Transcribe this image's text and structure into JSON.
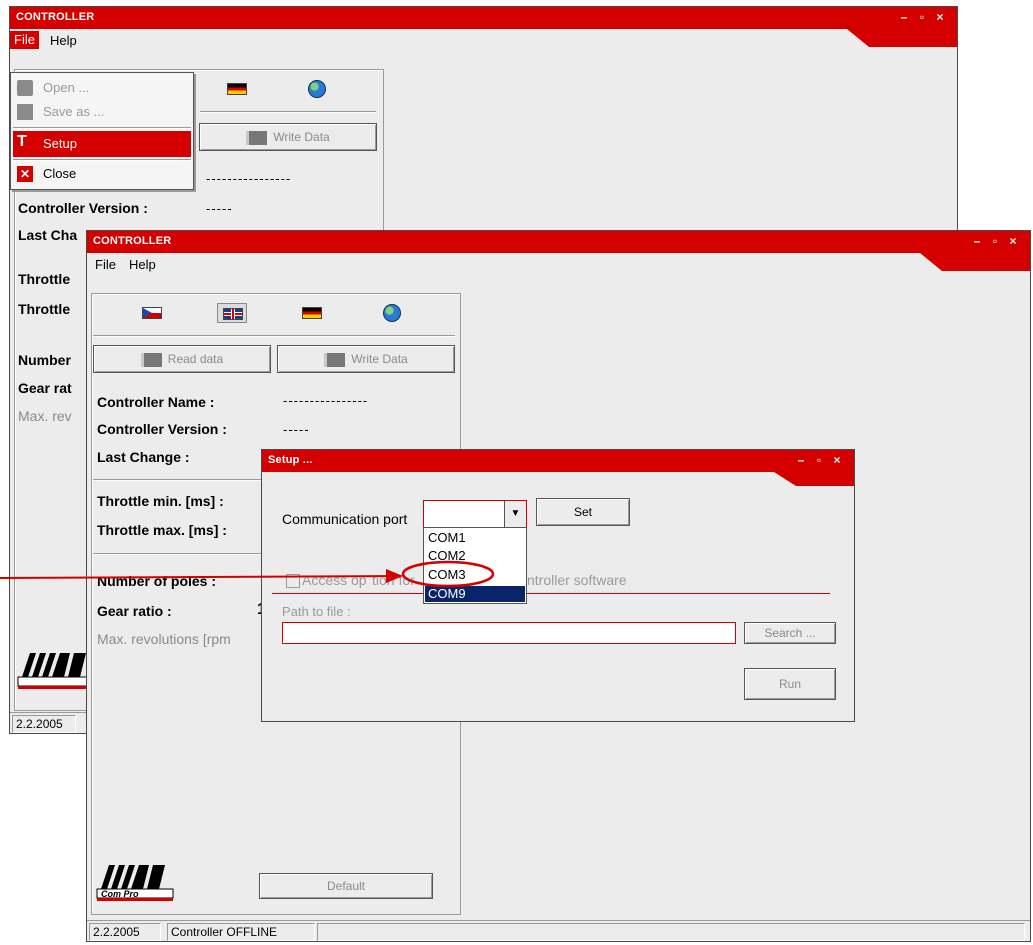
{
  "back_window": {
    "title": "CONTROLLER",
    "window_controls": [
      "–",
      "▫",
      "×"
    ],
    "menu": [
      "File",
      "Help"
    ],
    "write_button": "Write Data",
    "name_value": "----------------",
    "version_label": "Controller Version :",
    "version_value": "-----",
    "truncated_labels": [
      "Last Cha",
      "Throttle",
      "Throttle",
      "Number",
      "Gear rat",
      "Max. rev"
    ],
    "status_date": "2.2.2005",
    "file_menu": [
      {
        "label": "Open ...",
        "icon": "open-icon",
        "enabled": false
      },
      {
        "label": "Save as ...",
        "icon": "save-icon",
        "enabled": false
      },
      {
        "label": "Setup",
        "icon": "hammer-icon",
        "enabled": true,
        "highlighted": true
      },
      {
        "label": "Close",
        "icon": "close-icon",
        "enabled": true
      }
    ]
  },
  "main_window": {
    "title": "CONTROLLER",
    "window_controls": [
      "–",
      "▫",
      "×"
    ],
    "menu": [
      "File",
      "Help"
    ],
    "flags": [
      "czech-flag-icon",
      "uk-flag-icon",
      "german-flag-icon",
      "globe-icon"
    ],
    "read_button": "Read data",
    "write_button": "Write Data",
    "labels": {
      "name": "Controller Name :",
      "version": "Controller Version :",
      "last_change": "Last Change :",
      "throttle_min": "Throttle min. [ms] :",
      "throttle_max": "Throttle max. [ms] :",
      "poles": "Number of poles :",
      "gear": "Gear ratio :",
      "max_rev": "Max. revolutions [rpm"
    },
    "name_value": "----------------",
    "version_value": "-----",
    "gear_value_partial": "1",
    "default_button": "Default",
    "logo_text": "Com Pro",
    "status": [
      "2.2.2005",
      "Controller OFFLINE",
      ""
    ]
  },
  "setup_dialog": {
    "title": "Setup ...",
    "window_controls": [
      "–",
      "▫",
      "×"
    ],
    "comm_port_label": "Communication port",
    "comm_port_value": "",
    "set_button": "Set",
    "port_options": [
      "COM1",
      "COM2",
      "COM3",
      "COM9"
    ],
    "selected_option": "COM9",
    "circled_option": "COM3",
    "access_checkbox_label_left": "Access op",
    "access_checkbox_label_mid": "tion for",
    "access_checkbox_label_right": "ntroller software",
    "path_label": "Path to file :",
    "path_value": "",
    "search_button": "Search ...",
    "run_button": "Run"
  },
  "colors": {
    "accent": "#d40000",
    "selection": "#0a246a",
    "window_bg": "#ececec"
  }
}
